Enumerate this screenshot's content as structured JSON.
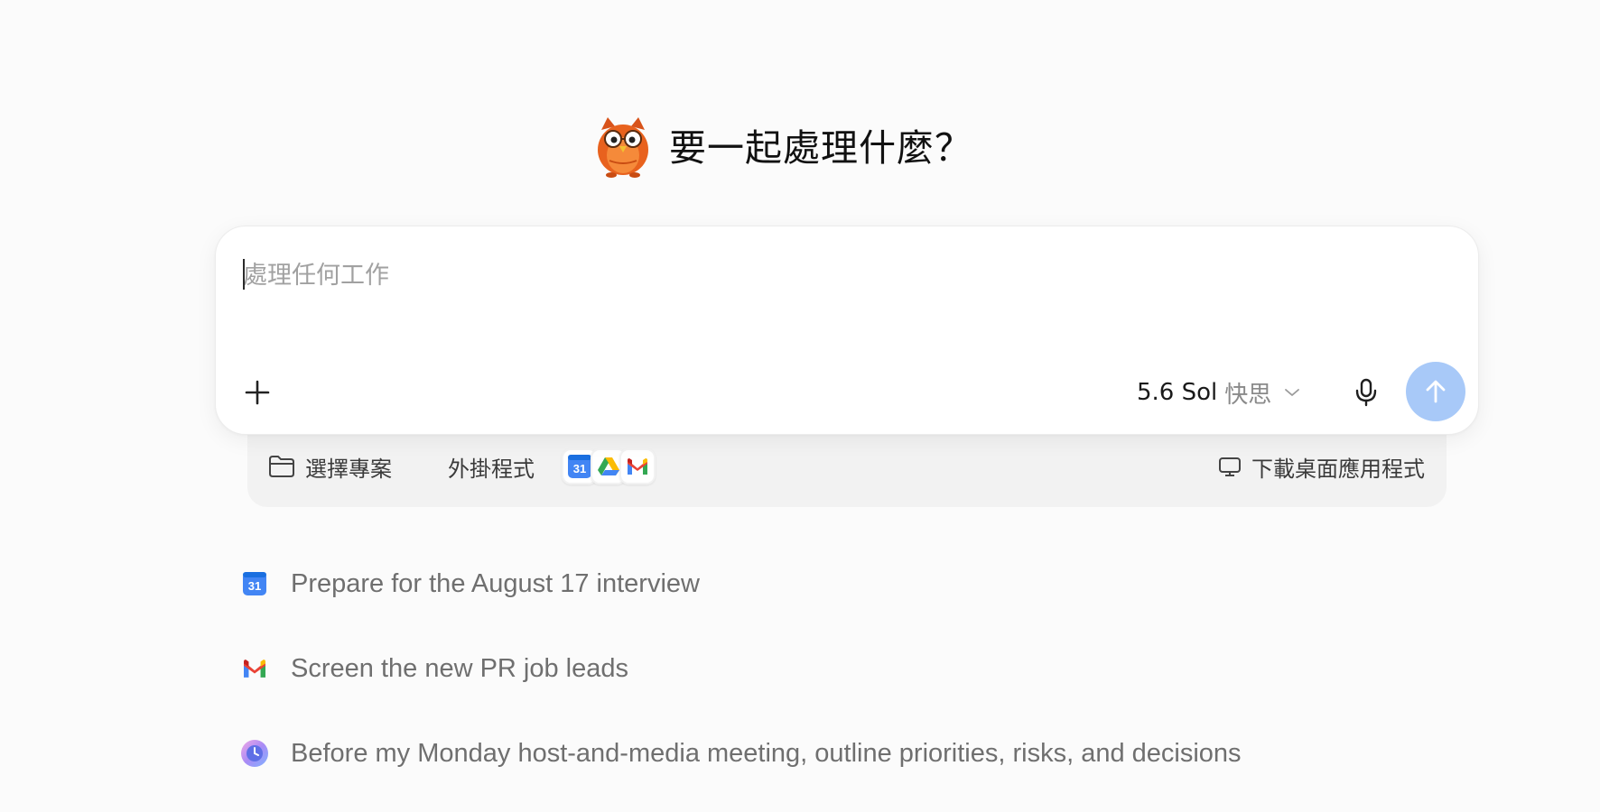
{
  "heading": {
    "title": "要一起處理什麼？",
    "icon": "owl-mascot-icon"
  },
  "composer": {
    "placeholder": "處理任何工作",
    "value": "",
    "add_icon": "plus-icon",
    "model": {
      "name": "5.6 Sol",
      "mode": "快思",
      "icon": "chevron-down-icon"
    },
    "mic_icon": "microphone-icon",
    "send_icon": "arrow-up-icon",
    "send_color": "#a8c9f8"
  },
  "tray": {
    "project_label": "選擇專案",
    "project_icon": "folder-icon",
    "plugins_label": "外掛程式",
    "apps": [
      {
        "name": "google-calendar-icon",
        "label": "31"
      },
      {
        "name": "google-drive-icon"
      },
      {
        "name": "gmail-icon"
      }
    ],
    "download_label": "下載桌面應用程式",
    "download_icon": "monitor-icon"
  },
  "suggestions": [
    {
      "icon": "google-calendar-icon",
      "icon_label": "31",
      "text": "Prepare for the August 17 interview"
    },
    {
      "icon": "gmail-icon",
      "text": "Screen the new PR job leads"
    },
    {
      "icon": "scheduled-task-icon",
      "text": "Before my Monday host-and-media meeting, outline priorities, risks, and decisions"
    }
  ]
}
